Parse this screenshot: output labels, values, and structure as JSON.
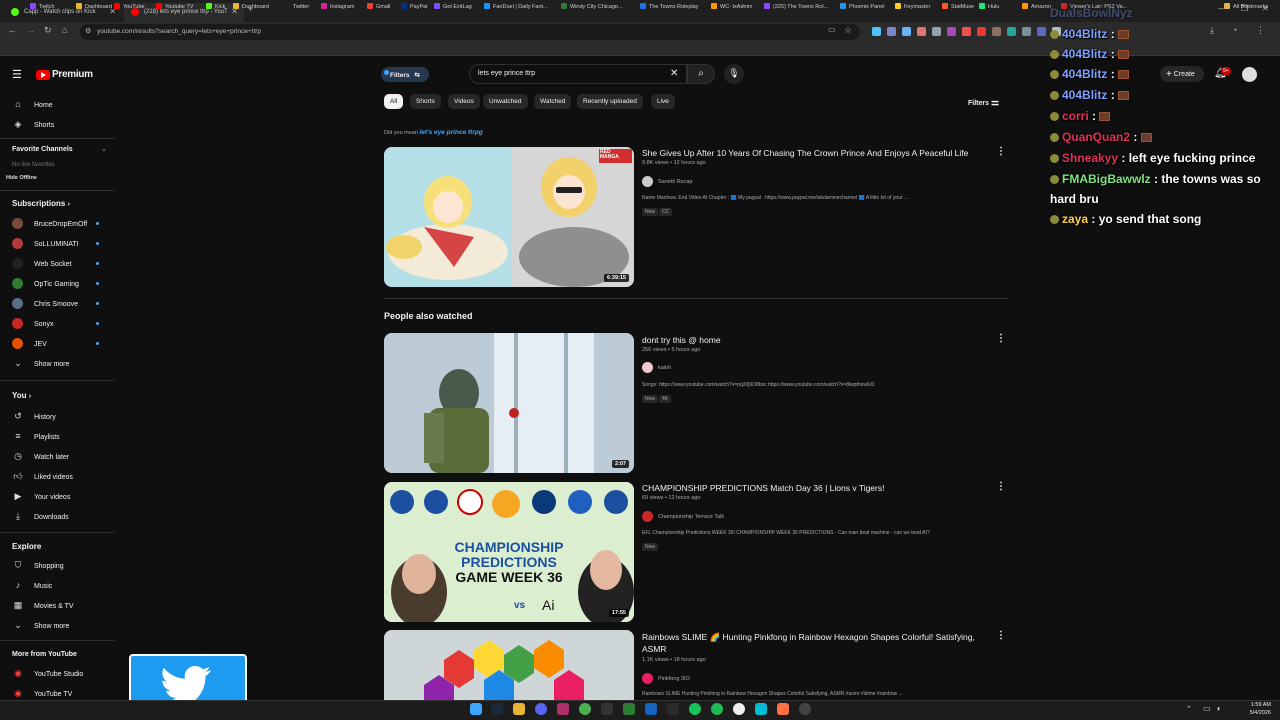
{
  "browser": {
    "tabs": [
      {
        "label": "Capp - Watch clips on Kick",
        "active": false
      },
      {
        "label": "(218) lets eye prince ttrp - YouT",
        "active": true
      }
    ],
    "url": "youtube.com/results?search_query=lets+eye+prince+ttrp",
    "bookmarks": [
      "Twitch",
      "Dashboard",
      "YouTube",
      "Youtube TV",
      "Kick",
      "Dashboard",
      "Twitter",
      "Instagram",
      "Gmail",
      "PayPal",
      "Get ExitLag",
      "FanDuel | Daily Fant...",
      "Windy City Chicago...",
      "The Towns Roleplay",
      "WC- txAdmin",
      "(225) The Towns Rol...",
      "Phoenix Panel",
      "Keymaster",
      "StatMuse",
      "Hulu",
      "Amazon",
      "Viewer's Lair: PS2 Va..."
    ],
    "all_bookmarks": "All Bookmarks"
  },
  "youtube": {
    "logo_text": "Premium",
    "filters_label": "Filters",
    "search_value": "lets eye prince ttrp",
    "create_label": "Create",
    "notif_count": "9+",
    "chips": [
      "All",
      "Shorts",
      "Videos",
      "Unwatched",
      "Watched",
      "Recently uploaded",
      "Live"
    ],
    "filters_right": "Filters",
    "did_you_mean_prefix": "Did you mean",
    "did_you_mean_query": "let's eye prince ttrpg"
  },
  "sidebar": {
    "home": "Home",
    "shorts": "Shorts",
    "favorite_channels": "Favorite Channels",
    "no_live": "No live favorites",
    "hide_offline": "Hide Offline",
    "subscriptions": "Subscriptions",
    "subs": [
      {
        "name": "BruceDropEmOff",
        "color": "#7a4a3a"
      },
      {
        "name": "SoLLUMINATI",
        "color": "#b33a3a"
      },
      {
        "name": "Web Socket",
        "color": "#222"
      },
      {
        "name": "OpTic Gaming",
        "color": "#2e7d32"
      },
      {
        "name": "Chris Smoove",
        "color": "#5a6e8a"
      },
      {
        "name": "Sonyx",
        "color": "#c62828"
      },
      {
        "name": "JEV",
        "color": "#e65100"
      }
    ],
    "show_more": "Show more",
    "you": "You",
    "you_items": [
      "History",
      "Playlists",
      "Watch later",
      "Liked videos",
      "Your videos",
      "Downloads"
    ],
    "explore": "Explore",
    "explore_items": [
      "Shopping",
      "Music",
      "Movies & TV"
    ],
    "show_more2": "Show more",
    "more_from": "More from YouTube",
    "more_items": [
      "YouTube Studio",
      "YouTube TV"
    ]
  },
  "results": [
    {
      "title": "She Gives Up After 10 Years Of Chasing The Crown Prince And Enjoys A Peaceful Life",
      "meta": "9.8K views • 12 hours ago",
      "channel": "Sanetti Recap",
      "desc": "Name Manhwa: End Video At Chapter : 🟦 My paypal : https://www.paypal.me/iakdammechannel 🟦 A little bit of your ...",
      "badges": [
        "New",
        "CC"
      ],
      "duration": "6:39:15"
    },
    {
      "title": "dont try this @ home",
      "meta": "256 views • 5 hours ago",
      "channel": "kaioh",
      "desc": "Songs: https://www.youtube.com/watch?v=pq20j9O8bxc https://www.youtube.com/watch?v=8iwpthswiU0.",
      "badges": [
        "New",
        "4K"
      ],
      "duration": "2:07"
    },
    {
      "title": "CHAMPIONSHIP PREDICTIONS Match Day 36 | Lions v Tigers!",
      "meta": "69 views • 12 hours ago",
      "channel": "Championship Terrace Talk",
      "desc": "EFL Championship Predictions WEEK 35! CHAMPIONSHIP WEEK 35 PREDICTIONS - Can man beat machine - can we beat AI?",
      "badges": [
        "New"
      ],
      "duration": "17:55",
      "thumb_text": [
        "CHAMPIONSHIP",
        "PREDICTIONS",
        "GAME WEEK 36"
      ],
      "thumb_vs": "vs",
      "thumb_ai": "Ai"
    },
    {
      "title": "Rainbows SLIME 🌈 Hunting Pinkfong in Rainbow Hexagon Shapes Colorful! Satisfying, ASMR",
      "meta": "1.1K views • 18 hours ago",
      "channel": "Pinkfong 3IO",
      "desc": "Rainbows SLIME Hunting Pinkfong in Rainbow Hexagon Shapes Colorful Satisfying, ASMR #asmr #slime #rainbow ..."
    }
  ],
  "people_also_watched": "People also watched",
  "thumb1_logo": "RED MANGA",
  "chat": [
    {
      "user": "404Blitz",
      "msg": "",
      "color": "#7fa0ff"
    },
    {
      "user": "404Blitz",
      "msg": "",
      "color": "#7fa0ff"
    },
    {
      "user": "404Blitz",
      "msg": "",
      "color": "#7fa0ff"
    },
    {
      "user": "404Blitz",
      "msg": "",
      "color": "#7fa0ff"
    },
    {
      "user": "corri",
      "msg": "",
      "color": "#e0305a"
    },
    {
      "user": "QuanQuan2",
      "msg": "",
      "color": "#e0305a"
    },
    {
      "user": "Shneakyy",
      "msg": "left eye fucking prince",
      "color": "#e0305a"
    },
    {
      "user": "FMABigBawwlz",
      "msg": "the towns was so",
      "color": "#7fe07f"
    },
    {
      "user": "",
      "msg": "hard bru",
      "color": "#fff"
    },
    {
      "user": "zaya",
      "msg": "yo send that song",
      "color": "#ffd23f"
    }
  ],
  "chat_top_partial": "DualsBowlNyz",
  "clock": {
    "time": "1:59 AM",
    "date": "5/4/2026"
  }
}
